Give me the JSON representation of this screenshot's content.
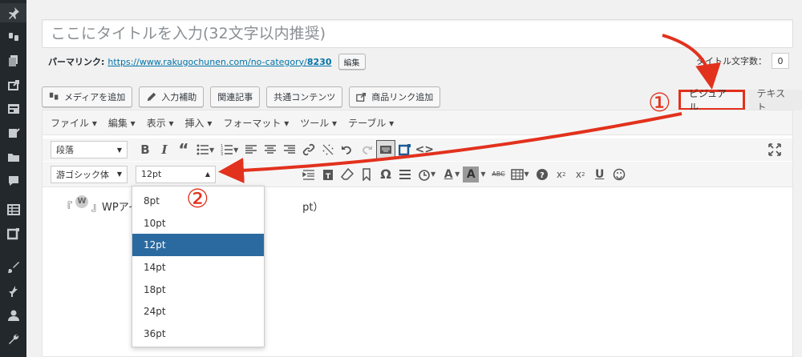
{
  "title_placeholder": "ここにタイトルを入力(32文字以内推奨)",
  "permalink": {
    "label": "パーマリンク:",
    "url_text": "https://www.rakugochunen.com/no-category/",
    "slug": "8230",
    "edit_label": "編集"
  },
  "title_count": {
    "label": "タイトル文字数：",
    "value": "0"
  },
  "media_buttons": [
    "メディアを追加",
    "入力補助",
    "関連記事",
    "共通コンテンツ",
    "商品リンク追加"
  ],
  "tabs": {
    "visual": "ビジュアル",
    "text": "テキスト"
  },
  "menubar": [
    "ファイル ▾",
    "編集 ▾",
    "表示 ▾",
    "挿入 ▾",
    "フォーマット ▾",
    "ツール ▾",
    "テーブル ▾"
  ],
  "format_select": "段落",
  "font_family_select": "游ゴシック体",
  "font_size_select": "12pt",
  "font_sizes": [
    "8pt",
    "10pt",
    "12pt",
    "14pt",
    "18pt",
    "24pt",
    "36pt"
  ],
  "selected_font_size": "12pt",
  "content": {
    "before": "『",
    "after": "』WPアイ",
    "tail": "pt）"
  },
  "annotations": {
    "one": "①",
    "two": "②"
  },
  "colors": {
    "accent_red": "#e2311d",
    "selected_blue": "#2b6aa0",
    "admin_sidebar": "#23282d"
  },
  "icons": [
    "pin-icon",
    "media-icon",
    "pages-icon",
    "share-icon",
    "layout-icon",
    "edit-icon",
    "folder-icon",
    "comment-icon",
    "table-icon",
    "block-icon",
    "brush-icon",
    "plugin-icon",
    "user-icon",
    "wrench-icon"
  ]
}
